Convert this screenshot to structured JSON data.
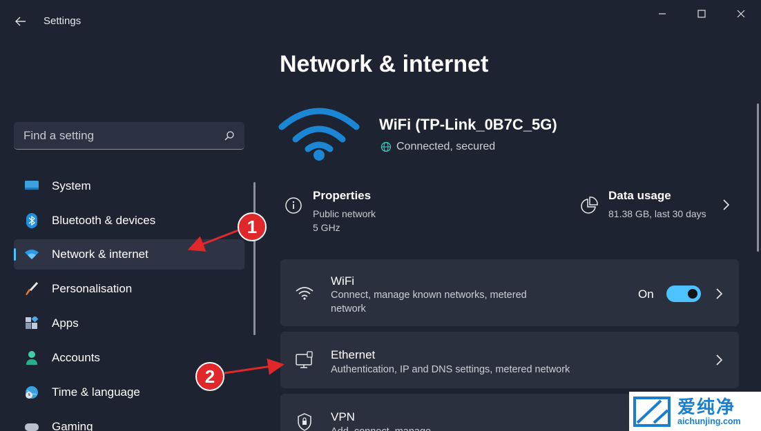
{
  "window": {
    "title": "Settings"
  },
  "search": {
    "placeholder": "Find a setting"
  },
  "sidebar": {
    "items": [
      {
        "label": "System"
      },
      {
        "label": "Bluetooth & devices"
      },
      {
        "label": "Network & internet"
      },
      {
        "label": "Personalisation"
      },
      {
        "label": "Apps"
      },
      {
        "label": "Accounts"
      },
      {
        "label": "Time & language"
      },
      {
        "label": "Gaming"
      }
    ]
  },
  "main": {
    "title": "Network & internet",
    "connection": {
      "name": "WiFi (TP-Link_0B7C_5G)",
      "status": "Connected, secured"
    },
    "properties": {
      "title": "Properties",
      "line1": "Public network",
      "line2": "5 GHz"
    },
    "data_usage": {
      "title": "Data usage",
      "value": "81.38 GB, last 30 days"
    },
    "cards": {
      "wifi": {
        "title": "WiFi",
        "sub_line1": "Connect, manage known networks, metered",
        "sub_line2": "network",
        "toggle_label": "On"
      },
      "ethernet": {
        "title": "Ethernet",
        "sub": "Authentication, IP and DNS settings, metered network"
      },
      "vpn": {
        "title": "VPN",
        "sub": "Add, connect, manage"
      }
    }
  },
  "annotations": {
    "marker1": "1",
    "marker2": "2"
  },
  "watermark": {
    "cn": "爱纯净",
    "url": "aichunjing.com"
  },
  "colors": {
    "background": "#1d2331",
    "accent": "#4cc2ff",
    "card": "#2a303e",
    "wifi_icon": "#1a86d4",
    "annotation": "#e0282a"
  }
}
